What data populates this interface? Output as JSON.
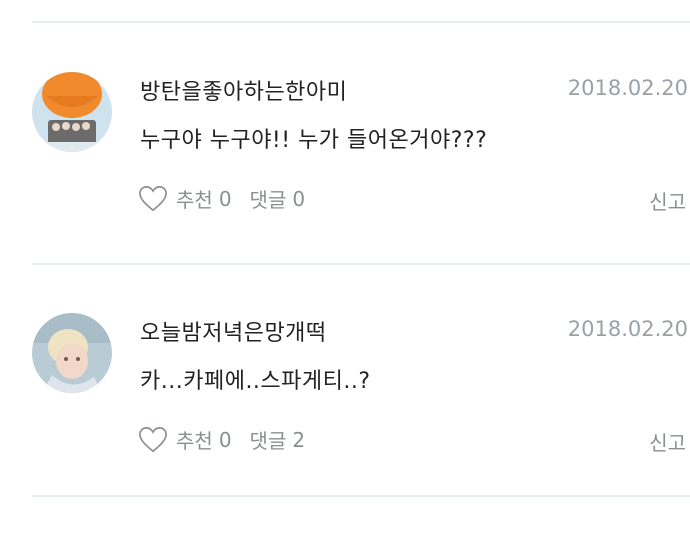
{
  "comments": [
    {
      "username": "방탄을좋아하는한아미",
      "date": "2018.02.20",
      "text": "누구야 누구야!! 누가 들어온거야???",
      "like_label": "추천",
      "like_count": "0",
      "reply_label": "댓글",
      "reply_count": "0",
      "report_label": "신고"
    },
    {
      "username": "오늘밤저녁은망개떡",
      "date": "2018.02.20",
      "text": "카...카페에..스파게티..?",
      "like_label": "추천",
      "like_count": "0",
      "reply_label": "댓글",
      "reply_count": "2",
      "report_label": "신고"
    }
  ],
  "icons": {
    "like": "heart-outline-icon"
  },
  "colors": {
    "text": "#222222",
    "muted": "#8a8f93",
    "date": "#9aa1a6",
    "divider": "#e6ecec"
  }
}
